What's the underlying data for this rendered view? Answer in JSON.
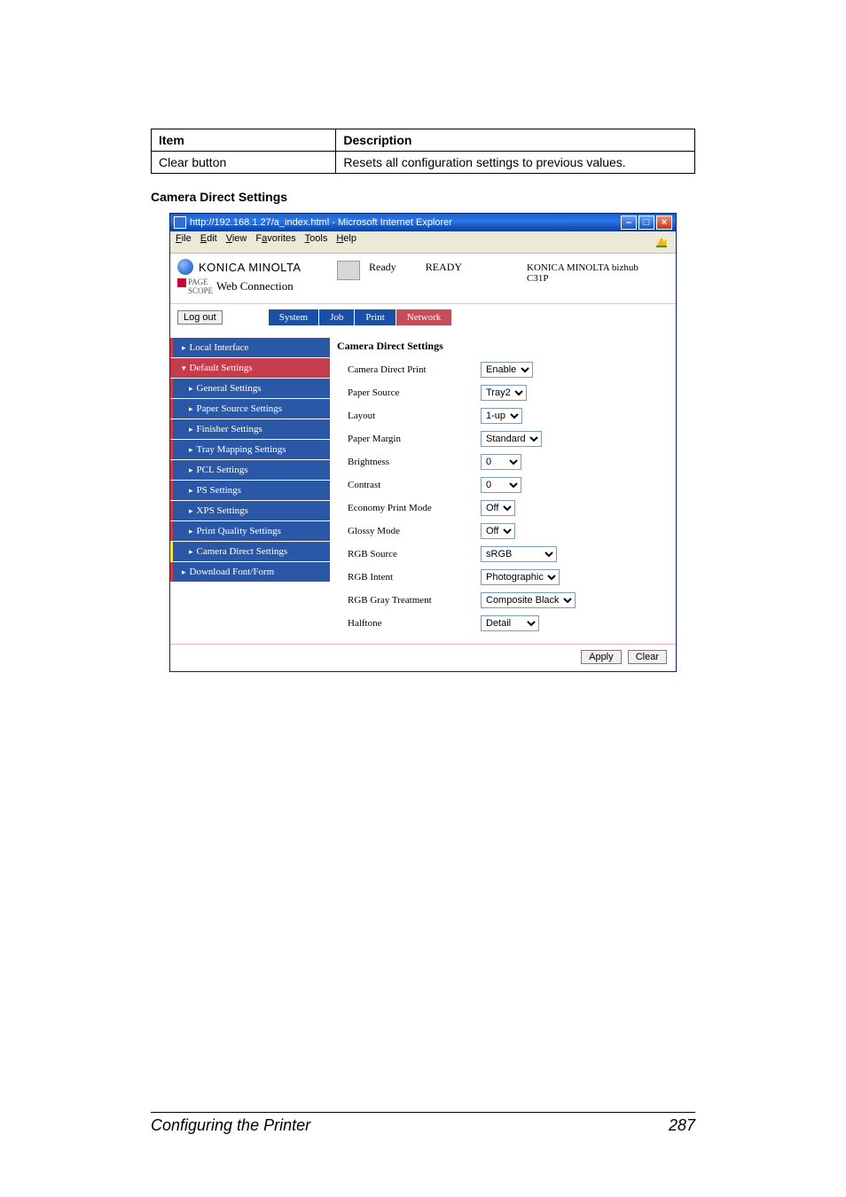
{
  "table": {
    "headers": [
      "Item",
      "Description"
    ],
    "row": {
      "item": "Clear button",
      "desc": "Resets all configuration settings to previous values."
    }
  },
  "sub_heading": "Camera Direct Settings",
  "ie": {
    "title": "http://192.168.1.27/a_index.html - Microsoft Internet Explorer",
    "menus": {
      "file": "File",
      "edit": "Edit",
      "view": "View",
      "fav": "Favorites",
      "tools": "Tools",
      "help": "Help"
    }
  },
  "brand": {
    "name": "KONICA MINOLTA",
    "pagescope_top": "PAGE",
    "pagescope_bot": "SCOPE",
    "webconn": "Web Connection"
  },
  "status": {
    "ready_small": "Ready",
    "ready_big": "READY",
    "model_line1": "KONICA MINOLTA bizhub",
    "model_line2": "C31P"
  },
  "logout": "Log out",
  "tabs": {
    "system": "System",
    "job": "Job",
    "print": "Print",
    "network": "Network"
  },
  "sidebar": {
    "local": "Local Interface",
    "default": "Default Settings",
    "general": "General Settings",
    "paper_src": "Paper Source Settings",
    "finisher": "Finisher Settings",
    "tray_map": "Tray Mapping Settings",
    "pcl": "PCL Settings",
    "ps": "PS Settings",
    "xps": "XPS Settings",
    "print_q": "Print Quality Settings",
    "camera": "Camera Direct Settings",
    "download": "Download Font/Form"
  },
  "form": {
    "title": "Camera Direct Settings",
    "rows": {
      "camera_direct_print": {
        "label": "Camera Direct Print",
        "value": "Enable"
      },
      "paper_source": {
        "label": "Paper Source",
        "value": "Tray2"
      },
      "layout": {
        "label": "Layout",
        "value": "1-up"
      },
      "paper_margin": {
        "label": "Paper Margin",
        "value": "Standard"
      },
      "brightness": {
        "label": "Brightness",
        "value": "0"
      },
      "contrast": {
        "label": "Contrast",
        "value": "0"
      },
      "economy": {
        "label": "Economy Print Mode",
        "value": "Off"
      },
      "glossy": {
        "label": "Glossy Mode",
        "value": "Off"
      },
      "rgb_source": {
        "label": "RGB Source",
        "value": "sRGB"
      },
      "rgb_intent": {
        "label": "RGB Intent",
        "value": "Photographic"
      },
      "rgb_gray": {
        "label": "RGB Gray Treatment",
        "value": "Composite Black"
      },
      "halftone": {
        "label": "Halftone",
        "value": "Detail"
      }
    }
  },
  "buttons": {
    "apply": "Apply",
    "clear": "Clear"
  },
  "footer": {
    "title": "Configuring the Printer",
    "page": "287"
  }
}
